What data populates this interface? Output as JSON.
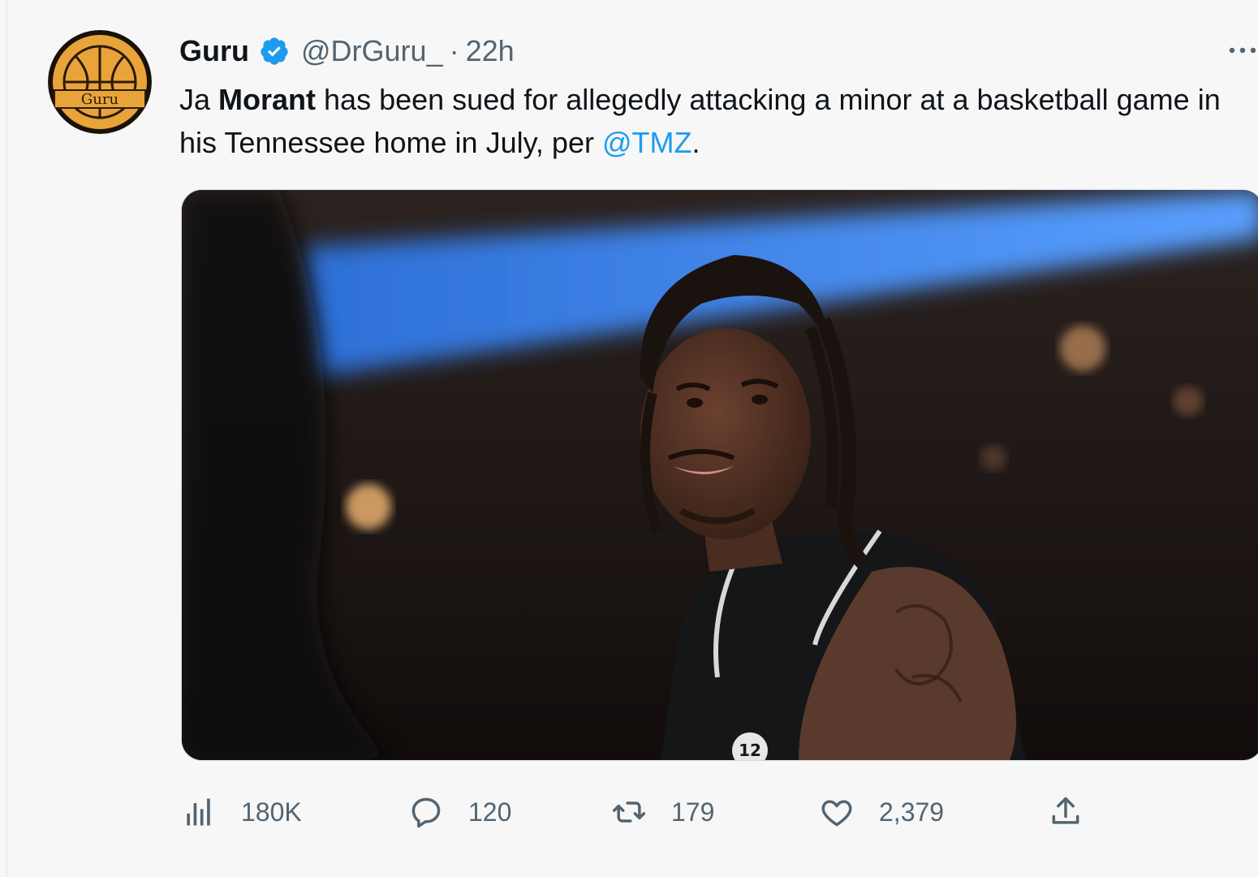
{
  "tweet": {
    "author": {
      "name": "Guru",
      "handle": "@DrGuru_",
      "avatar_text": "Guru",
      "verified": true
    },
    "separator": "·",
    "time": "22h",
    "text": {
      "part1": "Ja ",
      "bold": "Morant",
      "part2": " has been sued for allegedly attacking a minor at a basketball game in his Tennessee home in July, per ",
      "mention": "@TMZ",
      "part3": "."
    },
    "media": {
      "type": "photo",
      "jersey_number": "12"
    },
    "stats": {
      "views": "180K",
      "replies": "120",
      "retweets": "179",
      "likes": "2,379"
    }
  },
  "icons": {
    "views": "views-icon",
    "reply": "reply-icon",
    "retweet": "retweet-icon",
    "like": "like-icon",
    "share": "share-icon",
    "more": "more-icon",
    "verified": "verified-badge-icon"
  },
  "colors": {
    "accent": "#1d9bf0",
    "muted": "#536471",
    "text": "#0f1419",
    "avatar_bg": "#e8a43a"
  }
}
